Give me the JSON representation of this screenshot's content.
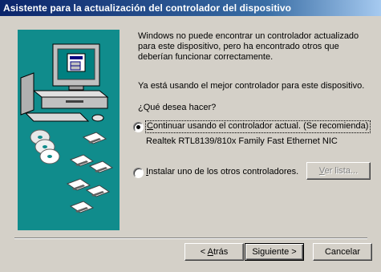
{
  "window": {
    "title": "Asistente para la actualización del controlador del dispositivo"
  },
  "content": {
    "intro_lines": [
      "Windows no puede encontrar un controlador actualizado",
      "para este dispositivo, pero ha encontrado otros que",
      "deberían funcionar correctamente."
    ],
    "status": "Ya está usando el mejor controlador para este dispositivo.",
    "question": "¿Qué desea hacer?",
    "option_continue": {
      "mnemonic": "C",
      "label_rest": "ontinuar usando el controlador actual. (Se recomienda)",
      "selected": true
    },
    "driver_name": "Realtek RTL8139/810x Family Fast Ethernet NIC",
    "option_install": {
      "mnemonic": "I",
      "label_rest": "nstalar uno de los otros controladores.",
      "selected": false
    },
    "view_list": {
      "mnemonic": "V",
      "label_rest": "er lista...",
      "enabled": false
    }
  },
  "footer": {
    "back": {
      "prefix": "< ",
      "mnemonic": "A",
      "label_rest": "trás"
    },
    "next": {
      "label": "Siguiente >"
    },
    "cancel": {
      "label": "Cancelar"
    }
  },
  "colors": {
    "title_gradient_start": "#0a246a",
    "title_gradient_end": "#a6caf0",
    "art_background": "#108c8c",
    "dialog_face": "#d4d0c8"
  },
  "icons": [
    "computer-icon",
    "cd-disc-icon",
    "floppy-disk-icon"
  ]
}
